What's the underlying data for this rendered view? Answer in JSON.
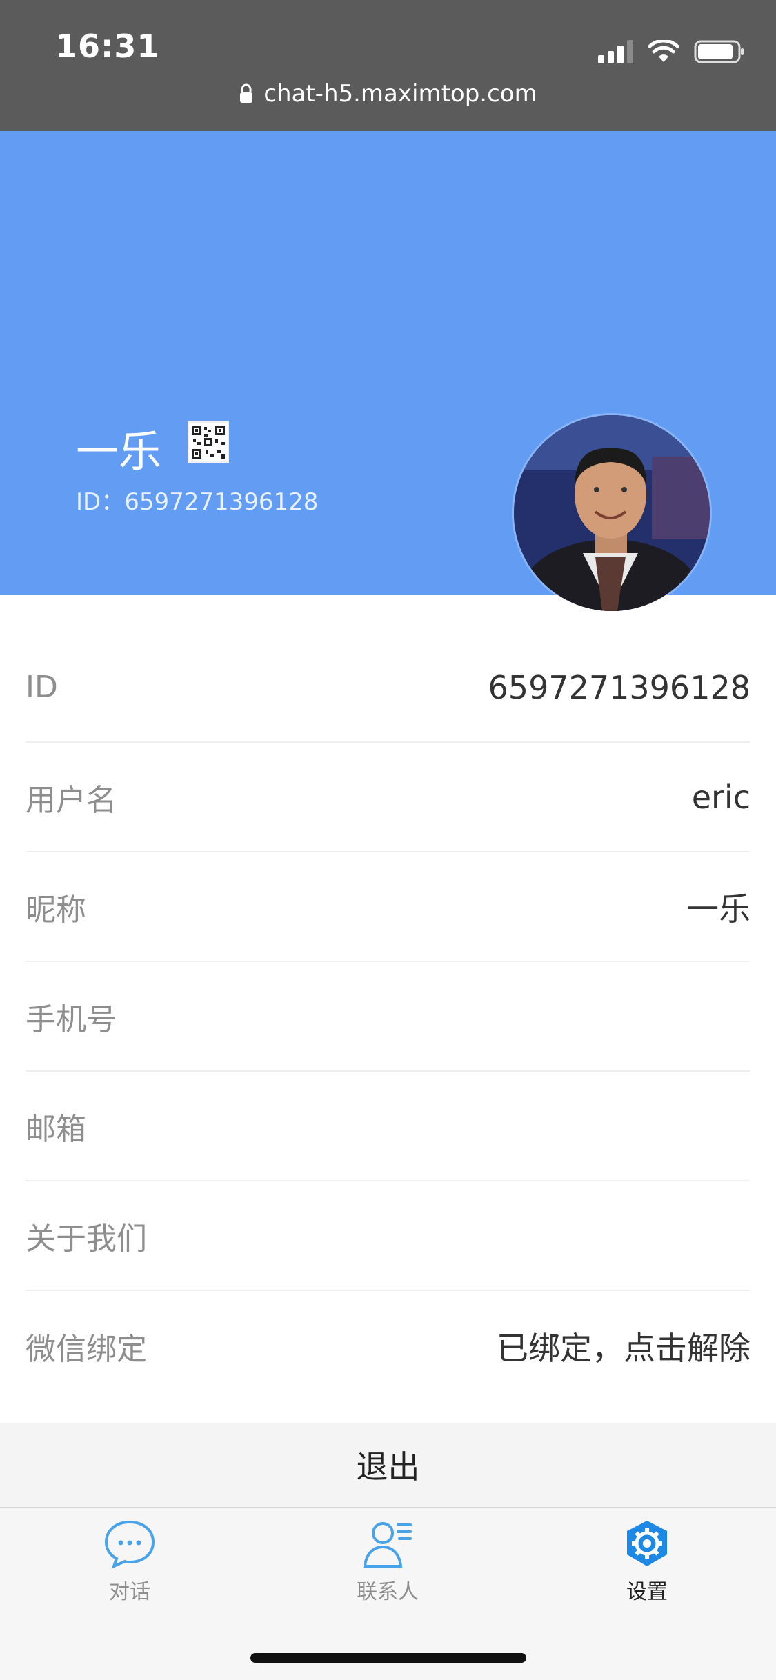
{
  "status_bar": {
    "time": "16:31",
    "url": "chat-h5.maximtop.com"
  },
  "profile": {
    "nickname": "一乐",
    "id_line": "ID：6597271396128"
  },
  "fields": [
    {
      "label": "ID",
      "value": "6597271396128"
    },
    {
      "label": "用户名",
      "value": "eric"
    },
    {
      "label": "昵称",
      "value": "一乐"
    },
    {
      "label": "手机号",
      "value": ""
    },
    {
      "label": "邮箱",
      "value": ""
    },
    {
      "label": "关于我们",
      "value": ""
    },
    {
      "label": "微信绑定",
      "value": "已绑定，点击解除"
    }
  ],
  "logout_label": "退出",
  "tabs": [
    {
      "label": "对话",
      "icon": "chat-bubble-icon",
      "active": false
    },
    {
      "label": "联系人",
      "icon": "contacts-icon",
      "active": false
    },
    {
      "label": "设置",
      "icon": "settings-gear-icon",
      "active": true
    }
  ],
  "colors": {
    "header_blue": "#629cf3",
    "tab_icon_blue": "#4aa3e8",
    "active_gear": "#1e88e5"
  }
}
